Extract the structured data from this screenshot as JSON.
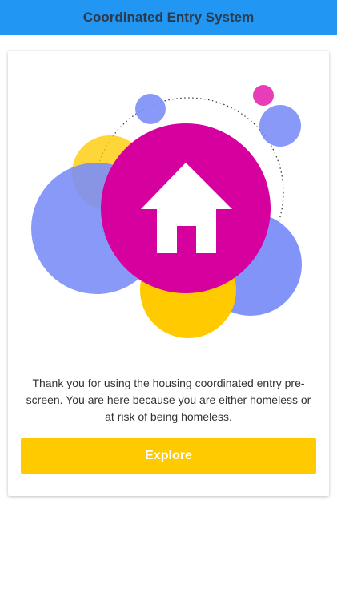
{
  "app_bar": {
    "title": "Coordinated Entry System",
    "background_color": "#2196F3",
    "title_color": "#2d3a4a"
  },
  "card": {
    "illustration": {
      "icon": "house-icon",
      "colors": {
        "magenta": "#D6009F",
        "blue": "#7B8EF7",
        "yellow": "#FFCA00",
        "pink_dot": "#E83CB9"
      }
    },
    "message": "Thank you for using the housing coordinated entry pre-screen. You are here because you are either homeless or at risk of being homeless.",
    "button": {
      "label": "Explore",
      "color": "#FFCA00"
    }
  }
}
